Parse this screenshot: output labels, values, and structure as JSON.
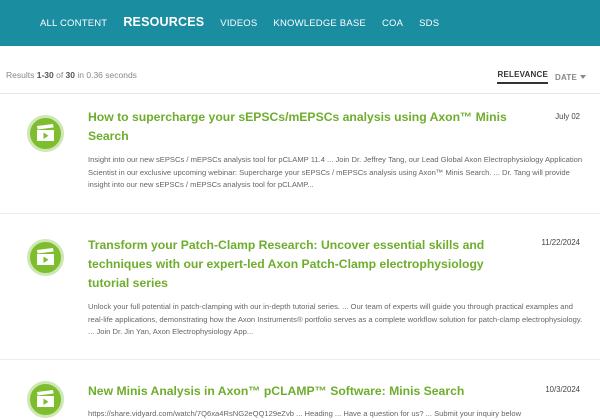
{
  "nav": {
    "items": [
      {
        "label": "ALL CONTENT",
        "active": false
      },
      {
        "label": "RESOURCES",
        "active": true
      },
      {
        "label": "VIDEOS",
        "active": false
      },
      {
        "label": "KNOWLEDGE BASE",
        "active": false
      },
      {
        "label": "COA",
        "active": false
      },
      {
        "label": "SDS",
        "active": false
      }
    ]
  },
  "results_summary": {
    "prefix": "Results ",
    "range": "1-30",
    "of": " of ",
    "total": "30",
    "suffix": " in 0.36 seconds"
  },
  "sort": {
    "relevance": "RELEVANCE",
    "date": "DATE"
  },
  "results": [
    {
      "icon": "video-icon",
      "title": "How to supercharge your sEPSCs/mEPSCs analysis using Axon™ Minis Search",
      "date": "July 02",
      "description": "Insight into our new sEPSCs / mEPSCs analysis tool for pCLAMP 11.4 ... Join Dr. Jeffrey Tang, our Lead Global Axon Electrophysiology Application Scientist in our exclusive upcoming webinar: Supercharge your sEPSCs / mEPSCs analysis using Axon™ Minis Search. ... Dr. Tang will provide insight into our new sEPSCs / mEPSCs analysis tool for pCLAMP..."
    },
    {
      "icon": "video-icon",
      "title": "Transform your Patch-Clamp Research: Uncover essential skills and techniques with our expert-led Axon Patch-Clamp electrophysiology tutorial series",
      "date": "11/22/2024",
      "description": "Unlock your full potential in patch-clamping with our in-depth tutorial series. ... Our team of experts will guide you through practical examples and real-life applications, demonstrating how the Axon Instruments® portfolio serves as a complete workflow solution for patch-clamp electrophysiology. ... Join Dr. Jin Yan, Axon Electrophysiology App..."
    },
    {
      "icon": "video-icon",
      "title": "New Minis Analysis in Axon™ pCLAMP™ Software: Minis Search",
      "date": "10/3/2024",
      "description": "https://share.vidyard.com/watch/7Q6xa4RsNG2eQQ129eZvb ... Heading ... Have a question for us? ... Submit your inquiry below"
    }
  ],
  "colors": {
    "nav_bg": "#1b8da1",
    "title_green": "#6fad2d",
    "icon_green": "#7dbd2e"
  }
}
